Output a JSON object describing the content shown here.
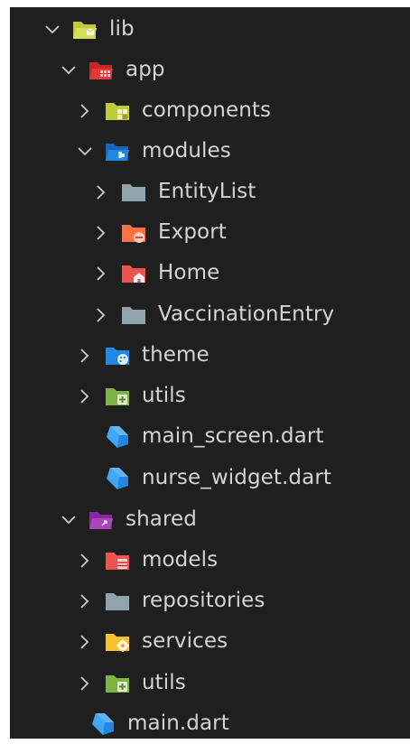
{
  "colors": {
    "background": "#1f1f1f",
    "text": "#d4d4d4",
    "chevron": "#cccccc",
    "folder_lib": "#c0ca33",
    "folder_app": "#e53935",
    "folder_components": "#c0ca33",
    "folder_modules": "#1e88e5",
    "folder_plain": "#90a4ae",
    "folder_export": "#ff7043",
    "folder_home": "#ef5350",
    "folder_theme": "#1e88e5",
    "folder_utils": "#7cb342",
    "folder_shared": "#ab47bc",
    "folder_models": "#ef5350",
    "folder_services": "#fbc02d",
    "dart": "#42a5f5"
  },
  "tree": {
    "lib": {
      "label": "lib",
      "icon": "folder-lib-open-icon",
      "expanded": true
    },
    "app": {
      "label": "app",
      "icon": "folder-app-open-icon",
      "expanded": true
    },
    "components": {
      "label": "components",
      "icon": "folder-components-icon",
      "expanded": false
    },
    "modules": {
      "label": "modules",
      "icon": "folder-modules-open-icon",
      "expanded": true
    },
    "entitylist": {
      "label": "EntityList",
      "icon": "folder-icon",
      "expanded": false
    },
    "export": {
      "label": "Export",
      "icon": "folder-export-icon",
      "expanded": false
    },
    "home": {
      "label": "Home",
      "icon": "folder-home-icon",
      "expanded": false
    },
    "vaccinationentry": {
      "label": "VaccinationEntry",
      "icon": "folder-icon",
      "expanded": false
    },
    "theme": {
      "label": "theme",
      "icon": "folder-theme-icon",
      "expanded": false
    },
    "utils_app": {
      "label": "utils",
      "icon": "folder-utils-icon",
      "expanded": false
    },
    "main_screen": {
      "label": "main_screen.dart",
      "icon": "dart-file-icon"
    },
    "nurse_widget": {
      "label": "nurse_widget.dart",
      "icon": "dart-file-icon"
    },
    "shared": {
      "label": "shared",
      "icon": "folder-shared-open-icon",
      "expanded": true
    },
    "models": {
      "label": "models",
      "icon": "folder-models-icon",
      "expanded": false
    },
    "repositories": {
      "label": "repositories",
      "icon": "folder-icon",
      "expanded": false
    },
    "services": {
      "label": "services",
      "icon": "folder-services-icon",
      "expanded": false
    },
    "utils_shared": {
      "label": "utils",
      "icon": "folder-utils-icon",
      "expanded": false
    },
    "main": {
      "label": "main.dart",
      "icon": "dart-file-icon"
    }
  }
}
